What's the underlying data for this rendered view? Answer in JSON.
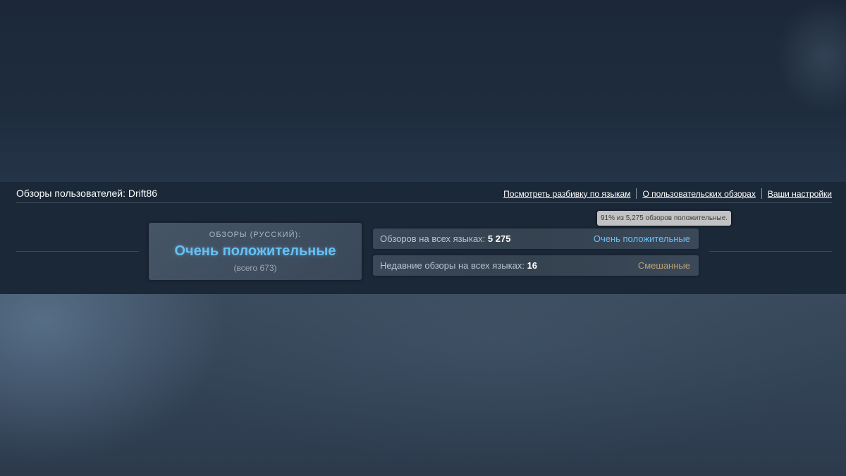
{
  "header": {
    "title": "Обзоры пользователей: Drift86",
    "links": [
      "Посмотреть разбивку по языкам",
      "О пользовательских обзорах",
      "Ваши настройки"
    ]
  },
  "tooltip": {
    "text": "91% из 5,275 обзоров положительные."
  },
  "summary": {
    "label": "ОБЗОРЫ (РУССКИЙ):",
    "rating": "Очень положительные",
    "total": "(всего 673)"
  },
  "rows": [
    {
      "label": "Обзоров на всех языках:",
      "count": "5 275",
      "status": "Очень положительные",
      "status_color": "#66c0f4"
    },
    {
      "label": "Недавние обзоры на всех языках:",
      "count": "16",
      "status": "Смешанные",
      "status_color": "#b9a074"
    }
  ],
  "colors": {
    "positive": "#66c0f4",
    "mixed": "#b9a074",
    "panel_bg": "#1b2838"
  }
}
